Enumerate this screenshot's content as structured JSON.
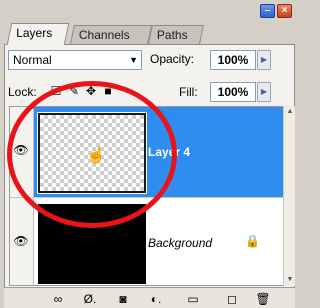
{
  "tabs": [
    "Layers",
    "Channels",
    "Paths"
  ],
  "blend_mode": "Normal",
  "opacity": {
    "label": "Opacity:",
    "value": "100%"
  },
  "lock": {
    "label": "Lock:"
  },
  "fill": {
    "label": "Fill:",
    "value": "100%"
  },
  "layers": [
    {
      "name": "Layer 4",
      "selected": true
    },
    {
      "name": "Background",
      "selected": false
    }
  ],
  "icons": {
    "eye": "eye-icon",
    "lock": "lock-icon",
    "cursor": "hand-cursor-icon",
    "chain": "link-layers-icon",
    "fx": "layer-style-icon",
    "mask": "add-mask-icon",
    "adj": "adjustment-layer-icon",
    "group": "new-group-icon",
    "new": "new-layer-icon",
    "trash": "delete-layer-icon"
  },
  "colors": {
    "selection": "#2f8df0",
    "annotation": "#e8141a"
  }
}
